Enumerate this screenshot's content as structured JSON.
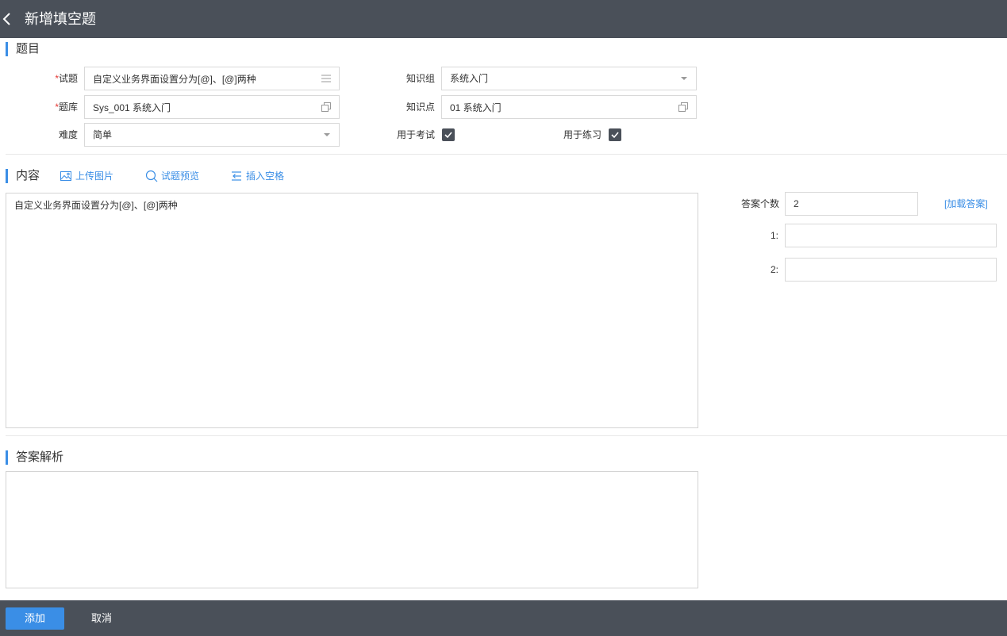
{
  "header": {
    "title": "新增填空题"
  },
  "sections": {
    "question": "题目",
    "content": "内容",
    "analysis": "答案解析"
  },
  "form": {
    "question": {
      "label": "试题",
      "value": "自定义业务界面设置分为[@]、[@]两种"
    },
    "bank": {
      "label": "题库",
      "value": "Sys_001 系统入门"
    },
    "difficulty": {
      "label": "难度",
      "value": "简单"
    },
    "knowledge_group": {
      "label": "知识组",
      "value": "系统入门"
    },
    "knowledge_point": {
      "label": "知识点",
      "value": "01 系统入门"
    },
    "for_exam": {
      "label": "用于考试",
      "checked": true
    },
    "for_practice": {
      "label": "用于练习",
      "checked": true
    },
    "required_mark": "*"
  },
  "toolbar": {
    "upload_image": "上传图片",
    "preview": "试题预览",
    "insert_blank": "插入空格"
  },
  "content": {
    "text": "自定义业务界面设置分为[@]、[@]两种"
  },
  "answers": {
    "count_label": "答案个数",
    "count_value": "2",
    "load_link": "[加载答案]",
    "items": [
      {
        "label": "1:",
        "value": ""
      },
      {
        "label": "2:",
        "value": ""
      }
    ]
  },
  "analysis": {
    "text": ""
  },
  "footer": {
    "add": "添加",
    "cancel": "取消"
  },
  "colors": {
    "header_bg": "#4a5059",
    "accent": "#3a8ee6",
    "required": "#e53935"
  }
}
